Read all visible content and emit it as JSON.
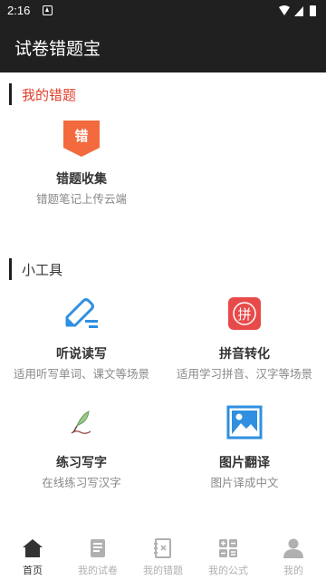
{
  "status_bar": {
    "time": "2:16"
  },
  "app_bar": {
    "title": "试卷错题宝"
  },
  "sections": {
    "my_mistakes": {
      "title": "我的错题",
      "color": "#e03e2d"
    },
    "tools": {
      "title": "小工具",
      "color": "#333333"
    }
  },
  "mistake_feature": {
    "icon_text": "错",
    "name": "错题收集",
    "desc": "错题笔记上传云端"
  },
  "tools": [
    {
      "name": "听说读写",
      "desc": "适用听写单词、课文等场景",
      "icon": "pen-edit-icon"
    },
    {
      "name": "拼音转化",
      "desc": "适用学习拼音、汉字等场景",
      "icon": "pinyin-icon",
      "icon_text": "拼"
    },
    {
      "name": "练习写字",
      "desc": "在线练习写汉字",
      "icon": "quill-icon"
    },
    {
      "name": "图片翻译",
      "desc": "图片译成中文",
      "icon": "picture-icon"
    }
  ],
  "tabs": [
    {
      "label": "首页",
      "icon": "home-icon",
      "active": true
    },
    {
      "label": "我的试卷",
      "icon": "paper-icon",
      "active": false
    },
    {
      "label": "我的错题",
      "icon": "notebook-icon",
      "active": false
    },
    {
      "label": "我的公式",
      "icon": "calculator-icon",
      "active": false
    },
    {
      "label": "我的",
      "icon": "user-icon",
      "active": false
    }
  ],
  "colors": {
    "bar": "#202020",
    "accent_red": "#e03e2d",
    "accent_orange": "#f26a3d",
    "accent_blue": "#2f8fe0"
  }
}
